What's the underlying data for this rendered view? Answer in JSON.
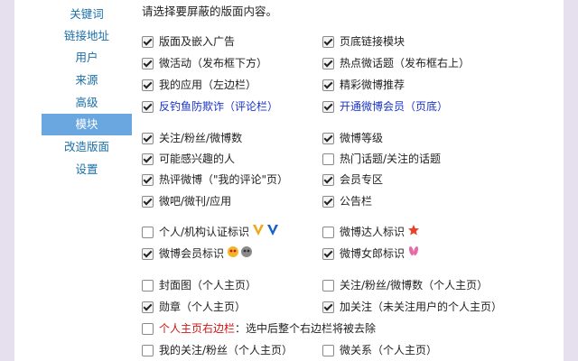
{
  "sidebar": {
    "items": [
      "关键词",
      "链接地址",
      "用户",
      "来源",
      "高级",
      "模块",
      "改造版面",
      "设置"
    ],
    "active_index": 5
  },
  "colors": {
    "accent": "#6aa7e0",
    "link": "#1a6ea8",
    "blue_text": "#1a35c8",
    "red_text": "#d01515"
  },
  "main": {
    "heading": "请选择要屏蔽的版面内容。",
    "groups": [
      {
        "options": [
          {
            "label": "版面及嵌入广告",
            "checked": true
          },
          {
            "label": "页底链接模块",
            "checked": true
          },
          {
            "label": "微活动（发布框下方）",
            "checked": true
          },
          {
            "label": "热点微话题（发布框右上）",
            "checked": true
          },
          {
            "label": "我的应用（左边栏）",
            "checked": true
          },
          {
            "label": "精彩微博推荐",
            "checked": true
          },
          {
            "label": "反钓鱼防欺诈（评论栏）",
            "checked": true,
            "style": "blue"
          },
          {
            "label": "开通微博会员（页底）",
            "checked": true,
            "style": "blue"
          }
        ]
      },
      {
        "options": [
          {
            "label": "关注/粉丝/微博数",
            "checked": true
          },
          {
            "label": "微博等级",
            "checked": true
          },
          {
            "label": "可能感兴趣的人",
            "checked": true
          },
          {
            "label": "热门话题/关注的话题",
            "checked": false
          },
          {
            "label": "热评微博（\"我的评论\"页）",
            "checked": true
          },
          {
            "label": "会员专区",
            "checked": true
          },
          {
            "label": "微吧/微刊/应用",
            "checked": true
          },
          {
            "label": "公告栏",
            "checked": true
          }
        ]
      },
      {
        "options": [
          {
            "label": "个人/机构认证标识",
            "checked": false,
            "icon": "verified-v-icons"
          },
          {
            "label": "微博达人标识",
            "checked": false,
            "icon": "star-badge-icon"
          },
          {
            "label": "微博会员标识",
            "checked": true,
            "icon": "member-face-icons"
          },
          {
            "label": "微博女郎标识",
            "checked": true,
            "icon": "bunny-ears-icon"
          }
        ]
      },
      {
        "options": [
          {
            "label": "封面图（个人主页）",
            "checked": false
          },
          {
            "label": "关注/粉丝/微博数（个人主页）",
            "checked": false
          },
          {
            "label": "勋章（个人主页）",
            "checked": true
          },
          {
            "label": "加关注（未关注用户的个人主页）",
            "checked": true
          }
        ]
      },
      {
        "options": [
          {
            "label": "个人主页右边栏",
            "checked": false,
            "style": "red",
            "suffix": "：选中后整个右边栏将被去除",
            "full_row": true
          },
          {
            "label": "我的关注/粉丝（个人主页）",
            "checked": false
          },
          {
            "label": "微关系（个人主页）",
            "checked": false
          }
        ]
      }
    ]
  }
}
